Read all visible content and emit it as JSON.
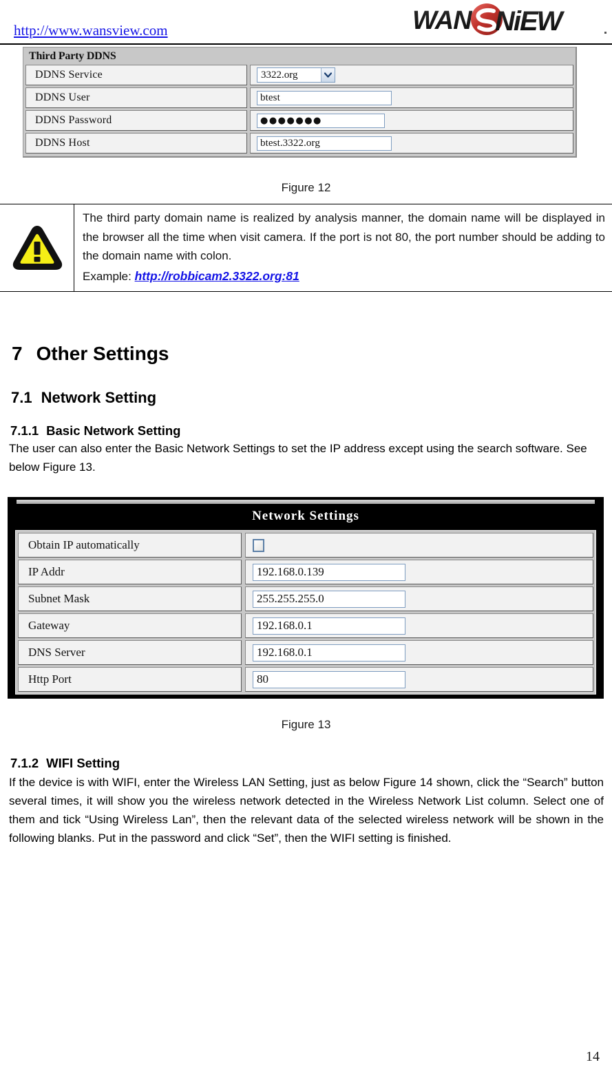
{
  "header": {
    "url": "http://www.wansview.com",
    "logo_text_left": "WAN",
    "logo_text_right": "NiEW",
    "logo_mark": "s-circle-mark",
    "brand_red": "#c0322c",
    "brand_black": "#111111"
  },
  "ddns_panel": {
    "title": "Third Party DDNS",
    "rows": [
      {
        "label": "DDNS Service",
        "type": "select",
        "value": "3322.org"
      },
      {
        "label": "DDNS User",
        "type": "text",
        "value": "btest"
      },
      {
        "label": "DDNS Password",
        "type": "password",
        "value": "●●●●●●●"
      },
      {
        "label": "DDNS Host",
        "type": "text",
        "value": "btest.3322.org"
      }
    ]
  },
  "figure12_caption": "Figure 12",
  "note": {
    "icon": "warning-triangle-icon",
    "icon_fill": "#f5ee16",
    "icon_stroke": "#111111",
    "paragraph": "The third party domain name is realized by analysis manner, the domain name will be displayed in the browser all the time when visit camera. If the port is not 80, the port number should be adding to the domain name with colon.",
    "example_prefix": "Example: ",
    "example_link": "http://robbicam2.3322.org:81"
  },
  "sections": {
    "s7": {
      "num": "7",
      "title": "Other Settings"
    },
    "s71": {
      "num": "7.1",
      "title": "Network Setting"
    },
    "s711": {
      "num": "7.1.1",
      "title": "Basic Network Setting",
      "body": "The user can also enter the Basic Network Settings to set the IP address except using the search software. See below Figure 13."
    },
    "s712": {
      "num": "7.1.2",
      "title": "WIFI Setting",
      "body": "If the device is with WIFI, enter the Wireless LAN Setting, just as below Figure 14 shown, click the “Search” button several times, it will show you the wireless network detected in the Wireless Network List column. Select one of them and tick “Using Wireless Lan”, then the relevant data of the selected wireless network will be shown in the following blanks. Put in the password and click “Set”, then the WIFI setting is finished."
    }
  },
  "network_panel": {
    "title": "Network Settings",
    "rows": [
      {
        "label": "Obtain IP automatically",
        "type": "checkbox",
        "value": "",
        "checked": false
      },
      {
        "label": "IP Addr",
        "type": "text",
        "value": "192.168.0.139"
      },
      {
        "label": "Subnet Mask",
        "type": "text",
        "value": "255.255.255.0"
      },
      {
        "label": "Gateway",
        "type": "text",
        "value": "192.168.0.1"
      },
      {
        "label": "DNS Server",
        "type": "text",
        "value": "192.168.0.1"
      },
      {
        "label": "Http Port",
        "type": "text",
        "value": "80"
      }
    ]
  },
  "figure13_caption": "Figure 13",
  "page_number": "14"
}
